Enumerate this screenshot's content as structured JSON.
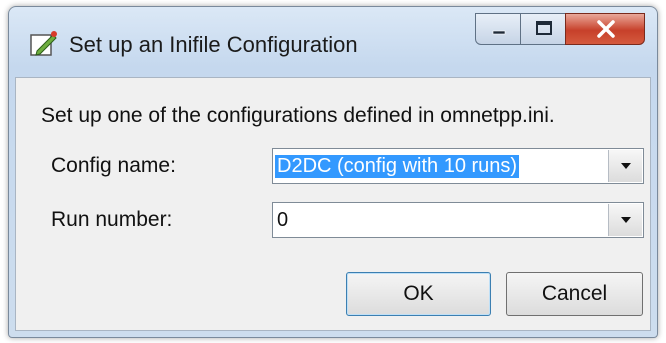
{
  "window": {
    "title": "Set up an Inifile Configuration"
  },
  "dialog": {
    "description": "Set up one of the configurations defined in omnetpp.ini.",
    "config_label": "Config name:",
    "config_value": "D2DC (config with 10 runs)",
    "run_label": "Run number:",
    "run_value": "0",
    "ok_label": "OK",
    "cancel_label": "Cancel"
  },
  "icons": {
    "app": "edit-config-icon",
    "minimize": "minimize-icon",
    "maximize": "maximize-icon",
    "close": "close-icon",
    "dropdown": "chevron-down-icon"
  },
  "colors": {
    "selection": "#3399ff",
    "close_button": "#c7402a"
  }
}
